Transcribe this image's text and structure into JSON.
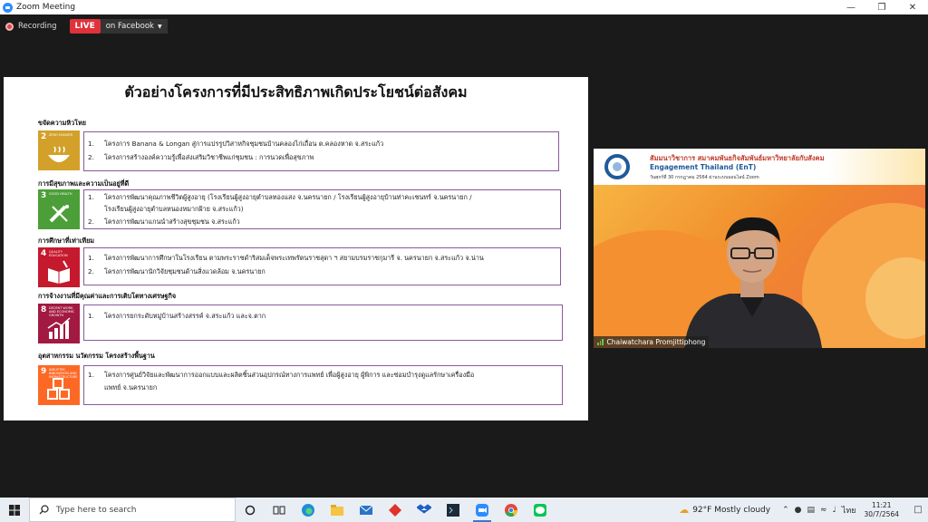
{
  "window": {
    "title": "Zoom Meeting"
  },
  "recording": {
    "label": "Recording",
    "live_badge": "LIVE",
    "live_target": "on Facebook"
  },
  "slide": {
    "title": "ตัวอย่างโครงการที่มีประสิทธิภาพเกิดประโยชน์ต่อสังคม",
    "sections": [
      {
        "heading": "ขจัดความหิวโหย",
        "sdg_number": "2",
        "sdg_label": "ZERO HUNGER",
        "sdg_color": "#d3a029",
        "items": [
          {
            "n": "1.",
            "text": "โครงการ Banana & Longan สู่การแปรรูปวิสาหกิจชุมชนบ้านคลองไก่เถื่อน ต.คลองหาด จ.สระแก้ว"
          },
          {
            "n": "2.",
            "text": "โครงการสร้างองค์ความรู้เพื่อส่งเสริมวิชาชีพแก่ชุมชน : การนวดเพื่อสุขภาพ"
          }
        ]
      },
      {
        "heading": "การมีสุขภาพและความเป็นอยู่ที่ดี",
        "sdg_number": "3",
        "sdg_label": "GOOD HEALTH",
        "sdg_color": "#4c9f38",
        "items": [
          {
            "n": "1.",
            "text": "โครงการพัฒนาคุณภาพชีวิตผู้สูงอายุ  (โรงเรียนผู้สูงอายุตำบลทองแสง จ.นครนายก / โรงเรียนผู้สูงอายุบ้านท่าคะเชนทร์ จ.นครนายก /"
          },
          {
            "n": "",
            "text": "โรงเรียนผู้สูงอายุตำบลหนองหมากฝ้าย จ.สระแก้ว)"
          },
          {
            "n": "2.",
            "text": "โครงการพัฒนาแกนนำสร้างสุขชุมชน จ.สระแก้ว"
          }
        ]
      },
      {
        "heading": "การศึกษาที่เท่าเทียม",
        "sdg_number": "4",
        "sdg_label": "QUALITY EDUCATION",
        "sdg_color": "#c5192d",
        "items": [
          {
            "n": "1.",
            "text": "โครงการพัฒนาการศึกษาในโรงเรียน ตามพระราชดำริสมเด็จพระเทพรัตนราชสุดา ฯ สยามบรมราชกุมารี  จ. นครนายก  จ.สระแก้ว  จ.น่าน"
          },
          {
            "n": "2.",
            "text": "โครงการพัฒนานักวิจัยชุมชนด้านสิ่งแวดล้อม จ.นครนายก"
          }
        ]
      },
      {
        "heading": "การจ้างงานที่มีคุณค่าและการเติบโตทางเศรษฐกิจ",
        "sdg_number": "8",
        "sdg_label": "DECENT WORK AND ECONOMIC GROWTH",
        "sdg_color": "#a21942",
        "items": [
          {
            "n": "1.",
            "text": "โครงการยกระดับหมู่บ้านสร้างสรรค์ จ.สระแก้ว และจ.ตาก"
          }
        ]
      },
      {
        "heading": "อุตสาหกรรม นวัตกรรม โครงสร้างพื้นฐาน",
        "sdg_number": "9",
        "sdg_label": "INDUSTRY, INNOVATION AND INFRASTRUCTURE",
        "sdg_color": "#fd6925",
        "items": [
          {
            "n": "1.",
            "text": "โครงการศูนย์วิจัยและพัฒนาการออกแบบและผลิตชิ้นส่วนอุปกรณ์ทางการแพทย์ เพื่อผู้สูงอายุ ผู้พิการ และซ่อมบำรุงดูแลรักษาเครื่องมือ"
          },
          {
            "n": "",
            "text": "แพทย์ จ.นครนายก"
          }
        ]
      }
    ]
  },
  "video": {
    "banner_line1": "สัมมนาวิชาการ สมาคมพันธกิจสัมพันธ์มหาวิทยาลัยกับสังคม",
    "banner_line2": "Engagement Thailand (EnT)",
    "banner_line3": "วันศุกร์ที่ 30 กรกฎาคม 2564 ผ่านระบบออนไลน์ Zoom",
    "participant_name": "Chaiwatchara Promjittiphong"
  },
  "taskbar": {
    "search_placeholder": "Type here to search",
    "weather": "92°F  Mostly cloudy",
    "language": "ไทย",
    "time": "11:21",
    "date": "30/7/2564"
  }
}
